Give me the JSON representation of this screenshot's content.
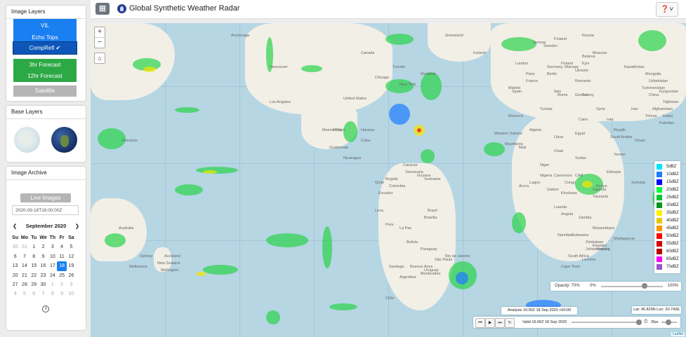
{
  "header": {
    "title": "Global Synthetic Weather Radar"
  },
  "image_layers": {
    "heading": "Image Layers",
    "vil": "VIL",
    "echo_tops": "Echo Tops",
    "comp_refl": "CompRefl",
    "forecast_3hr": "3hr Forecast",
    "forecast_12hr": "12hr Forecast",
    "satellite": "Satellite"
  },
  "base_layers": {
    "heading": "Base Layers"
  },
  "archive": {
    "heading": "Image Archive",
    "live_button": "Live Images",
    "date_value": "2020-09-18T16:00:00Z",
    "calendar": {
      "month": "September 2020",
      "weekdays": [
        "Su",
        "Mo",
        "Tu",
        "We",
        "Th",
        "Fr",
        "Sa"
      ],
      "weeks": [
        [
          "30",
          "31",
          "1",
          "2",
          "3",
          "4",
          "5"
        ],
        [
          "6",
          "7",
          "8",
          "9",
          "10",
          "11",
          "12"
        ],
        [
          "13",
          "14",
          "15",
          "16",
          "17",
          "18",
          "19"
        ],
        [
          "20",
          "21",
          "22",
          "23",
          "24",
          "25",
          "26"
        ],
        [
          "27",
          "28",
          "29",
          "30",
          "1",
          "2",
          "3"
        ],
        [
          "4",
          "5",
          "6",
          "7",
          "8",
          "9",
          "10"
        ]
      ]
    }
  },
  "legend": [
    "5dBZ",
    "10dBZ",
    "15dBZ",
    "20dBZ",
    "25dBZ",
    "30dBZ",
    "35dBZ",
    "40dBZ",
    "45dBZ",
    "50dBZ",
    "55dBZ",
    "60dBZ",
    "65dBZ",
    "70dBZ"
  ],
  "legend_colors": [
    "#00e5ff",
    "#1e7cff",
    "#0000ff",
    "#00ff3c",
    "#00c832",
    "#009620",
    "#fff000",
    "#e6c800",
    "#ff9600",
    "#ff0000",
    "#d40000",
    "#b80000",
    "#ff00ff",
    "#9955c9"
  ],
  "map": {
    "labels": [
      "United States",
      "Mexico",
      "Canada",
      "Brazil",
      "Peru",
      "Bolivia",
      "Argentina",
      "Chile",
      "Colombia",
      "Venezuela",
      "Paraguay",
      "Uruguay",
      "Ecuador",
      "Russia",
      "Kazakhstan",
      "Mongolia",
      "China",
      "Iran",
      "Turkey",
      "Egypt",
      "Libya",
      "Algeria",
      "Niger",
      "Sudan",
      "Chad",
      "Nigeria",
      "Ethiopia",
      "Kenya",
      "Tanzania",
      "Angola",
      "Zambia",
      "Namibia",
      "Botswana",
      "Mozambique",
      "South Africa",
      "Madagascar",
      "Australia",
      "New Zealand",
      "Finland",
      "Sweden",
      "Norway",
      "Ukraine",
      "Poland",
      "France",
      "Spain",
      "Germany",
      "Romania",
      "Iraq",
      "Syria",
      "Saudi Arabia",
      "Yemen",
      "Oman",
      "Mali",
      "Mauritania",
      "Afghanistan",
      "Pakistan",
      "Turkmenistan",
      "Uzbekistan",
      "Western Sahara",
      "Morocco",
      "Tunisia",
      "Cuba",
      "Guatemala",
      "Nicaragua",
      "Greenland",
      "Iceland",
      "Belarus",
      "Italy",
      "Greece",
      "Kyrgyzstan",
      "Tajikistan",
      "Somalia",
      "Uganda",
      "Congo",
      "Gabon",
      "Cameroon",
      "CAR",
      "Zimbabwe",
      "Lesotho",
      "Eswatini",
      "Suriname",
      "Guyana",
      "Lima",
      "Rio de Janeiro",
      "São Paulo",
      "Buenos Aires",
      "Santiago",
      "Montevideo",
      "La Paz",
      "Quito",
      "Bogotá",
      "Caracas",
      "Brasília",
      "Johannesburg",
      "Cape Town",
      "Maputo",
      "Kinshasa",
      "Luanda",
      "Lagos",
      "Accra",
      "Cairo",
      "Riyadh",
      "Tehran",
      "Kabul",
      "Moscow",
      "Kyiv",
      "London",
      "Paris",
      "Madrid",
      "Rome",
      "Berlin",
      "Warsaw",
      "Sydney",
      "Melbourne",
      "Auckland",
      "Wellington",
      "Mexico City",
      "Havana",
      "Los Angeles",
      "New York",
      "Chicago",
      "Toronto",
      "Montreal",
      "Vancouver",
      "Anchorage",
      "Honolulu"
    ],
    "opacity_label": "Opacity: 70%",
    "opacity_min": "0%",
    "opacity_max": "100%",
    "opacity_value": 0.7,
    "analysis": "Analysis 16:00Z 18 Sep 2020 +00:00",
    "coords": "Lat: 45.829N Lon: 20.742E",
    "valid": "Valid 16:00Z 18 Sep 2020",
    "rate": "2fps",
    "attribution": "Leaflet"
  }
}
